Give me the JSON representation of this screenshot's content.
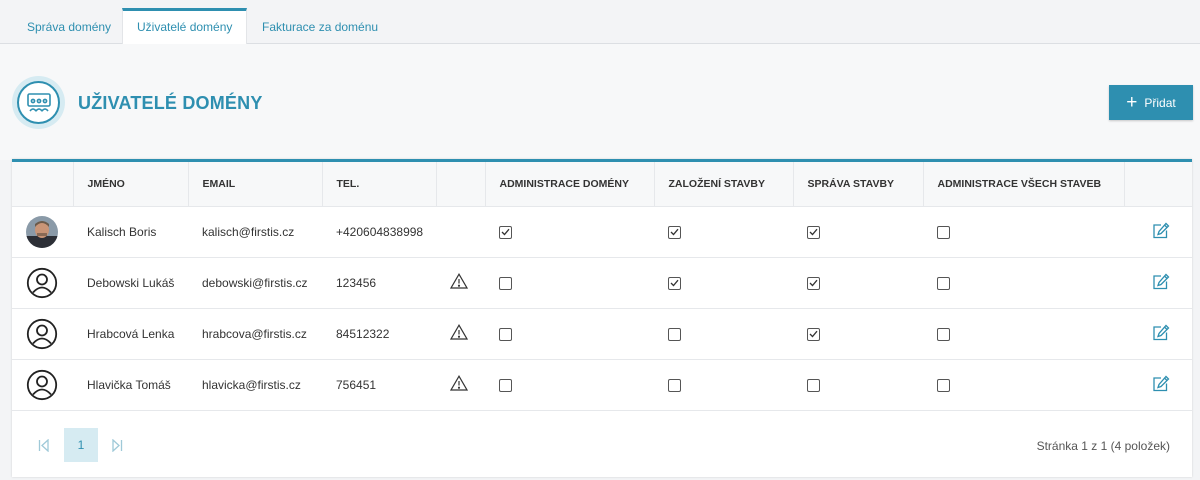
{
  "tabs": [
    {
      "label": "Správa domény"
    },
    {
      "label": "Uživatelé domény"
    },
    {
      "label": "Fakturace za doménu"
    }
  ],
  "header": {
    "title": "UŽIVATELÉ DOMÉNY",
    "add_label": "Přidat"
  },
  "table": {
    "columns": [
      "",
      "JMÉNO",
      "EMAIL",
      "TEL.",
      "",
      "ADMINISTRACE DOMÉNY",
      "ZALOŽENÍ STAVBY",
      "SPRÁVA STAVBY",
      "ADMINISTRACE VŠECH STAVEB",
      ""
    ],
    "rows": [
      {
        "avatar": "photo",
        "name": "Kalisch Boris",
        "email": "kalisch@firstis.cz",
        "tel": "+420604838998",
        "warning": false,
        "admin_domain": true,
        "create_build": true,
        "manage_build": true,
        "admin_all": false
      },
      {
        "avatar": "user-icon",
        "name": "Debowski Lukáš",
        "email": "debowski@firstis.cz",
        "tel": "123456",
        "warning": true,
        "admin_domain": false,
        "create_build": true,
        "manage_build": true,
        "admin_all": false
      },
      {
        "avatar": "user-icon",
        "name": "Hrabcová Lenka",
        "email": "hrabcova@firstis.cz",
        "tel": "84512322",
        "warning": true,
        "admin_domain": false,
        "create_build": false,
        "manage_build": true,
        "admin_all": false
      },
      {
        "avatar": "user-icon",
        "name": "Hlavička Tomáš",
        "email": "hlavicka@firstis.cz",
        "tel": "756451",
        "warning": true,
        "admin_domain": false,
        "create_build": false,
        "manage_build": false,
        "admin_all": false
      }
    ]
  },
  "pager": {
    "current": "1",
    "info": "Stránka 1 z 1 (4 položek)"
  },
  "colors": {
    "accent": "#2e8fb0",
    "accent_light": "#d6ebf2"
  },
  "icons": [
    "users-icon",
    "plus-icon",
    "user-icon",
    "warning-icon",
    "edit-icon",
    "first-page-icon",
    "last-page-icon"
  ]
}
